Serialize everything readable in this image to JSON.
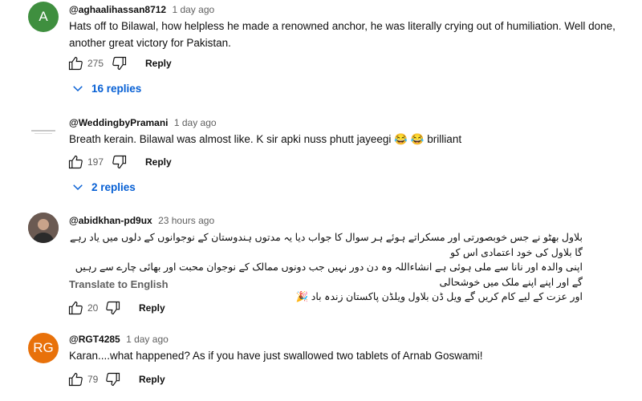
{
  "comments": [
    {
      "avatar_letter": "A",
      "avatar_color": "#3f8f3f",
      "handle": "@aghaalihassan8712",
      "time": "1 day ago",
      "text": "Hats off to Bilawal, how helpless he made a renowned anchor, he was literally crying out of humiliation. Well done, another great victory for Pakistan.",
      "likes": "275",
      "reply_label": "Reply",
      "replies_label": "16 replies"
    },
    {
      "avatar_letter": "",
      "avatar_color": "#ffffff",
      "handle": "@WeddingbyPramani",
      "time": "1 day ago",
      "text": "Breath kerain. Bilawal was almost like. K sir apki nuss phutt jayeegi 😂 😂 brilliant",
      "likes": "197",
      "reply_label": "Reply",
      "replies_label": "2 replies"
    },
    {
      "avatar_letter": "",
      "avatar_color": "#5a4a44",
      "handle": "@abidkhan-pd9ux",
      "time": "23 hours ago",
      "text_lines": [
        "بلاول بھٹو نے جس خوبصورتی اور مسکراتے ہوئے ہر سوال کا جواب دیا یہ مدتوں ہندوستان کے نوجوانوں کے دلوں میں یاد رہے گا بلاول کی خود اعتمادی اس کو",
        "اپنی والدہ اور نانا سے ملی ہوئی ہے انشاءاللہ وہ دن دور نہیں جب دونوں ممالک کے نوجوان محبت اور بھائی چارے سے رہیں گے اور اپنے اپنے ملک میں خوشحالی",
        "اور عزت کے لیے کام کریں گے ویل ڈن بلاول ویلڈن پاکستان زندہ باد 🎉"
      ],
      "translate_label": "Translate to English",
      "likes": "20",
      "reply_label": "Reply"
    },
    {
      "avatar_letter": "RG",
      "avatar_color": "#e8710a",
      "handle": "@RGT4285",
      "time": "1 day ago",
      "text": "Karan....what happened? As if you have just swallowed two tablets of Arnab Goswami!",
      "likes": "79",
      "reply_label": "Reply"
    }
  ],
  "colors": {
    "link": "#065fd4",
    "meta": "#606060"
  }
}
